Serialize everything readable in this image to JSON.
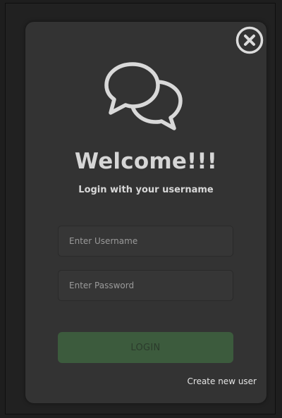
{
  "dialog": {
    "close_icon": "close-circle-icon",
    "chat_icon": "chat-bubbles-icon",
    "title": "Welcome!!!",
    "subtitle": "Login with your username",
    "username_placeholder": "Enter Username",
    "username_value": "",
    "password_placeholder": "Enter Password",
    "password_value": "",
    "login_label": "LOGIN",
    "create_user_label": "Create new user"
  },
  "colors": {
    "background": "#1e1e1e",
    "dialog": "#333333",
    "text": "#d6d6d6",
    "login_button": "#3c5b3d"
  }
}
